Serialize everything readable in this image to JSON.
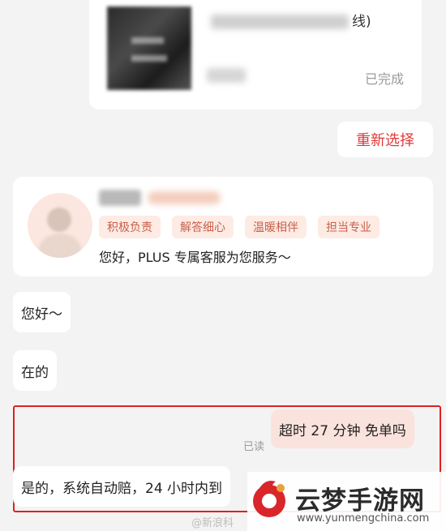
{
  "order": {
    "title_suffix": "线)",
    "status": "已完成"
  },
  "reselect": {
    "label": "重新选择"
  },
  "agent": {
    "tags": [
      "积极负责",
      "解答细心",
      "温暖相伴",
      "担当专业"
    ],
    "greeting": "您好，PLUS 专属客服为您服务～"
  },
  "messages": [
    {
      "side": "left",
      "text": "您好～"
    },
    {
      "side": "left",
      "text": "在的"
    },
    {
      "side": "right",
      "text": "超时 27 分钟 免单吗"
    },
    {
      "side": "left",
      "text": "是的，系统自动赔，24 小时内到"
    }
  ],
  "read_status": "已读",
  "watermark": {
    "title": "云梦手游网",
    "url": "www.yunmengchina.com",
    "weibo": "@新浪科"
  },
  "colors": {
    "accent_red": "#e2393a",
    "highlight_border": "#e02020",
    "tag_bg": "#fdebe4",
    "outgoing_bubble": "#fbe3dd"
  }
}
